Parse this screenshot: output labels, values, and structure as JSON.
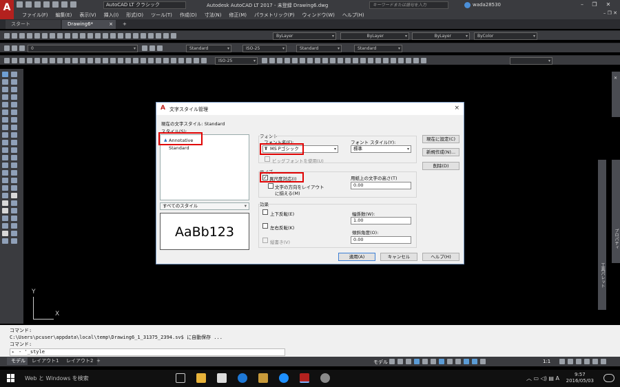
{
  "app": {
    "logo": "A",
    "logo_sub": "LT",
    "workspace": "AutoCAD LT クラシック",
    "title": "Autodesk AutoCAD LT 2017 - 未登録    Drawing6.dwg",
    "search_placeholder": "キーワードまたは語句を入力",
    "user": "wada28530"
  },
  "menu": [
    "ファイル(F)",
    "編集(E)",
    "表示(V)",
    "挿入(I)",
    "形式(O)",
    "ツール(T)",
    "作成(D)",
    "寸法(N)",
    "修正(M)",
    "パラメトリック(P)",
    "ウィンドウ(W)",
    "ヘルプ(H)"
  ],
  "tabs": {
    "start": "スタート",
    "drawing": "Drawing6*",
    "close": "×",
    "plus": "+"
  },
  "toolbar": {
    "bylayer1": "ByLayer",
    "bylayer2": "ByLayer",
    "bylayer3": "ByLayer",
    "bycolor": "ByColor",
    "layer": "0",
    "text_style": "Standard",
    "dim_style": "ISO-25",
    "table_style": "Standard",
    "mleader_style": "Standard",
    "dim_style2": "ISO-25"
  },
  "right_palette": {
    "label": "プロパティ",
    "label2": "工具パレット"
  },
  "ucs": {
    "x": "X",
    "y": "Y"
  },
  "command": {
    "line1": "コマンド:",
    "line2": "C:\\Users\\pcuser\\appdata\\local\\temp\\Drawing6_1_31375_2394.sv$ に自動保存 ...",
    "line3": "コマンド:",
    "input": "- '_style"
  },
  "layout_tabs": {
    "model": "モデル",
    "layout1": "レイアウト1",
    "layout2": "レイアウト2",
    "plus": "+"
  },
  "status": {
    "model": "モデル",
    "scale": "1:1"
  },
  "taskbar": {
    "search": "Web と Windows を検索",
    "ime": "A",
    "time": "9:57",
    "date": "2016/05/03"
  },
  "dialog": {
    "title": "文字スタイル管理",
    "current_style_label": "現在の文字スタイル: ",
    "current_style_value": "Standard",
    "styles_label": "スタイル(S):",
    "styles": [
      "Annotative",
      "Standard"
    ],
    "filter": "すべてのスタイル",
    "preview": "AaBb123",
    "font_group": "フォント",
    "font_name_label": "フォント名(F):",
    "font_name": "MS Pゴシック",
    "font_style_label": "フォント スタイル(Y):",
    "font_style": "標準",
    "bigfont": "ビッグフォントを使用(U)",
    "size_group": "サイズ",
    "annotative": "異尺度対応(I)",
    "match_orient_1": "文字の方向をレイアウト",
    "match_orient_2": "に揃える(M)",
    "paper_height_label": "用紙上の文字の高さ(T)",
    "paper_height": "0.00",
    "effects_group": "効果",
    "upside_down": "上下反転(E)",
    "backwards": "左右反転(K)",
    "vertical": "縦書き(V)",
    "width_label": "幅係数(W):",
    "width": "1.00",
    "oblique_label": "傾斜角度(O):",
    "oblique": "0.00",
    "set_current": "現在に設定(C)",
    "new": "新規作成(N)...",
    "delete": "削除(D)",
    "apply": "適用(A)",
    "cancel": "キャンセル",
    "help": "ヘルプ(H)",
    "close": "×"
  }
}
